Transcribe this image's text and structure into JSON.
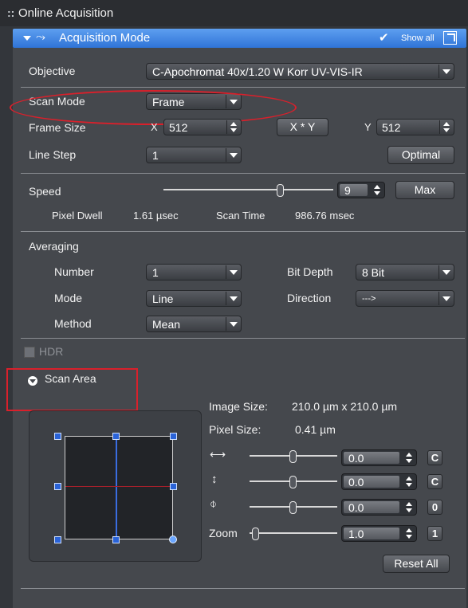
{
  "header": {
    "title": "Online Acquisition"
  },
  "acq_bar": {
    "title": "Acquisition Mode",
    "show_all": "Show all"
  },
  "objective": {
    "label": "Objective",
    "value": "C-Apochromat 40x/1.20 W Korr UV-VIS-IR"
  },
  "scan_mode": {
    "label": "Scan Mode",
    "value": "Frame"
  },
  "frame_size": {
    "label": "Frame Size",
    "x_label": "X",
    "x_value": "512",
    "xy_button": "X * Y",
    "y_label": "Y",
    "y_value": "512"
  },
  "line_step": {
    "label": "Line Step",
    "value": "1",
    "optimal_button": "Optimal"
  },
  "speed": {
    "label": "Speed",
    "value": "9",
    "max_button": "Max",
    "slider_fraction": 0.69,
    "pixel_dwell_label": "Pixel Dwell",
    "pixel_dwell_value": "1.61 µsec",
    "scan_time_label": "Scan Time",
    "scan_time_value": "986.76 msec"
  },
  "averaging": {
    "title": "Averaging",
    "number_label": "Number",
    "number_value": "1",
    "bit_depth_label": "Bit Depth",
    "bit_depth_value": "8 Bit",
    "mode_label": "Mode",
    "mode_value": "Line",
    "direction_label": "Direction",
    "direction_value": "--->",
    "method_label": "Method",
    "method_value": "Mean"
  },
  "hdr": {
    "label": "HDR",
    "checked": false
  },
  "scan_area": {
    "title": "Scan Area",
    "image_size_label": "Image Size:",
    "image_size_value": "210.0 µm x 210.0 µm",
    "pixel_size_label": "Pixel Size:",
    "pixel_size_value": "0.41 µm",
    "offset_x": {
      "value": "0.0",
      "reset": "C"
    },
    "offset_y": {
      "value": "0.0",
      "reset": "C"
    },
    "rotation": {
      "value": "0.0",
      "reset": "0"
    },
    "zoom_label": "Zoom",
    "zoom_value": "1.0",
    "zoom_reset": "1",
    "reset_all": "Reset All"
  },
  "colors": {
    "accent": "#3f83e0",
    "annotation": "#d9202b",
    "panel": "#45484d"
  }
}
